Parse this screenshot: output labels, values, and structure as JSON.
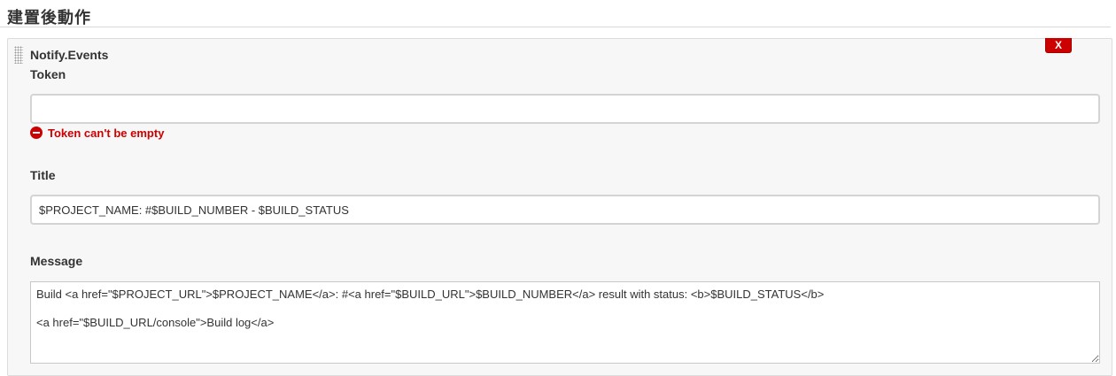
{
  "section": {
    "title": "建置後動作"
  },
  "step": {
    "title": "Notify.Events",
    "delete_label": "X"
  },
  "fields": {
    "token": {
      "label": "Token",
      "value": "",
      "error": "Token can't be empty"
    },
    "title": {
      "label": "Title",
      "value": "$PROJECT_NAME: #$BUILD_NUMBER - $BUILD_STATUS"
    },
    "message": {
      "label": "Message",
      "value": "Build <a href=\"$PROJECT_URL\">$PROJECT_NAME</a>: #<a href=\"$BUILD_URL\">$BUILD_NUMBER</a> result with status: <b>$BUILD_STATUS</b>\n\n<a href=\"$BUILD_URL/console\">Build log</a>"
    }
  },
  "colors": {
    "error": "#cc0000",
    "delete_button": "#cc0000"
  }
}
